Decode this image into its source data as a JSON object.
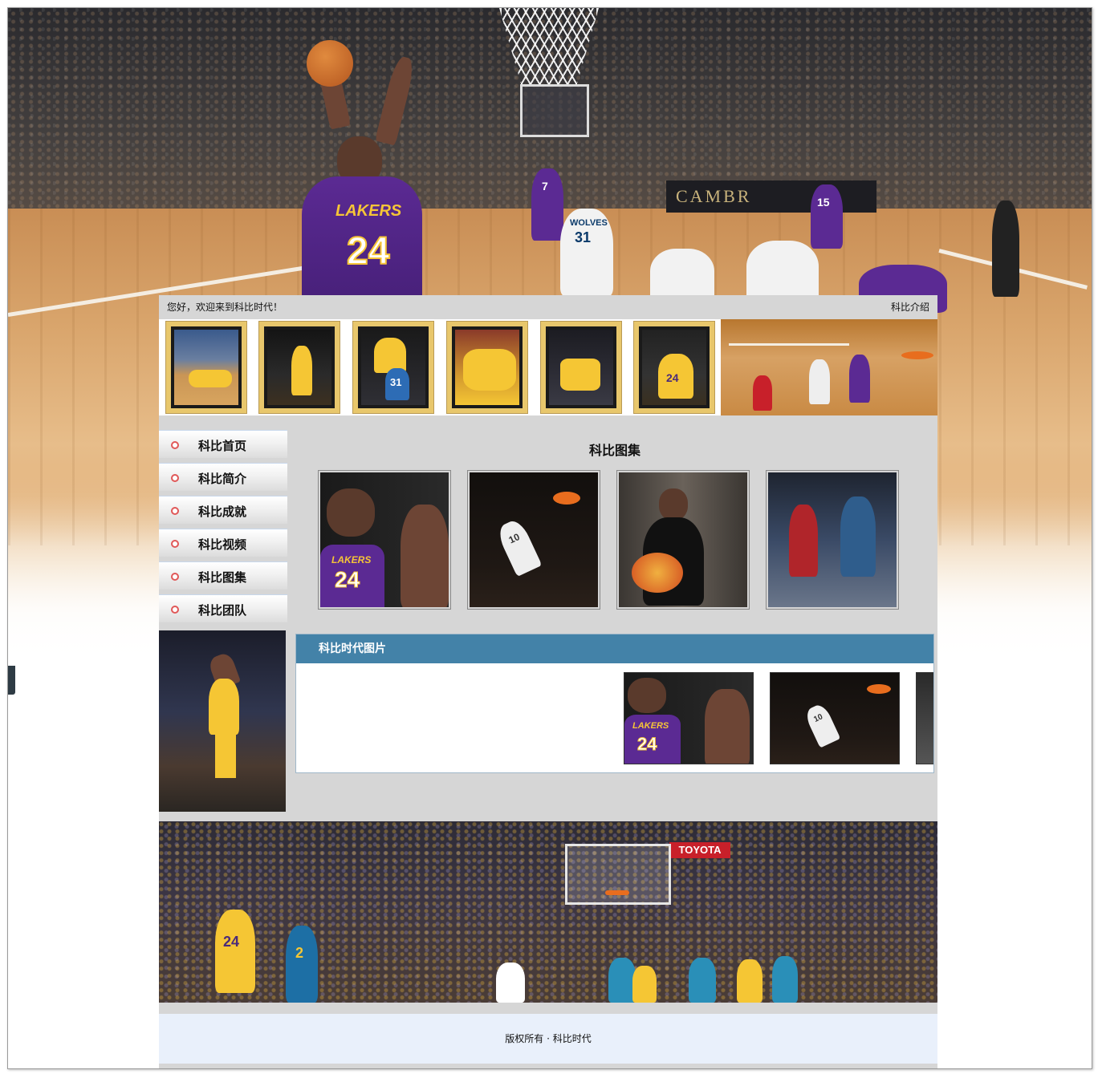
{
  "header": {
    "welcome_text": "您好，欢迎来到科比时代！",
    "intro_link": "科比介绍",
    "hero_banner_text": "CAMBR",
    "hero_jersey_number": "24",
    "hero_jersey_team": "LAKERS",
    "hero_defender_team": "WOLVES",
    "hero_defender_number": "31",
    "hero_teammate_number": "7",
    "hero_teammate2_number": "15"
  },
  "strip_thumbs": [
    {
      "label": "kobe-on-floor"
    },
    {
      "label": "kobe-standing"
    },
    {
      "label": "kobe-with-31",
      "jersey": "31"
    },
    {
      "label": "kobe-hug"
    },
    {
      "label": "kobe-seated"
    },
    {
      "label": "kobe-shooting",
      "jersey": "24"
    }
  ],
  "menu": {
    "items": [
      {
        "label": "科比首页"
      },
      {
        "label": "科比简介"
      },
      {
        "label": "科比成就"
      },
      {
        "label": "科比视频"
      },
      {
        "label": "科比图集"
      },
      {
        "label": "科比团队"
      }
    ]
  },
  "gallery": {
    "title": "科比图集",
    "images": [
      {
        "name": "gallery-kobe-talk",
        "jersey": "24",
        "team": "LAKERS"
      },
      {
        "name": "gallery-dunk",
        "jersey": "10"
      },
      {
        "name": "gallery-guitar"
      },
      {
        "name": "gallery-allstar"
      }
    ]
  },
  "era": {
    "title": "科比时代图片",
    "images": [
      {
        "name": "era-kobe-talk",
        "jersey": "24",
        "team": "LAKERS"
      },
      {
        "name": "era-dunk",
        "jersey": "10"
      },
      {
        "name": "era-partial"
      }
    ]
  },
  "bottom_banner": {
    "sponsor_text": "TOYOTA",
    "kobe_number": "24",
    "defender_number": "2"
  },
  "footer": {
    "copyright": "版权所有 · 科比时代"
  },
  "colors": {
    "page_bg": "#d6d6d6",
    "era_header": "#4382a8",
    "footer_bg": "#e9f0fb",
    "menu_dot": "#e05858",
    "lakers_purple": "#552583",
    "lakers_gold": "#fdb927"
  }
}
